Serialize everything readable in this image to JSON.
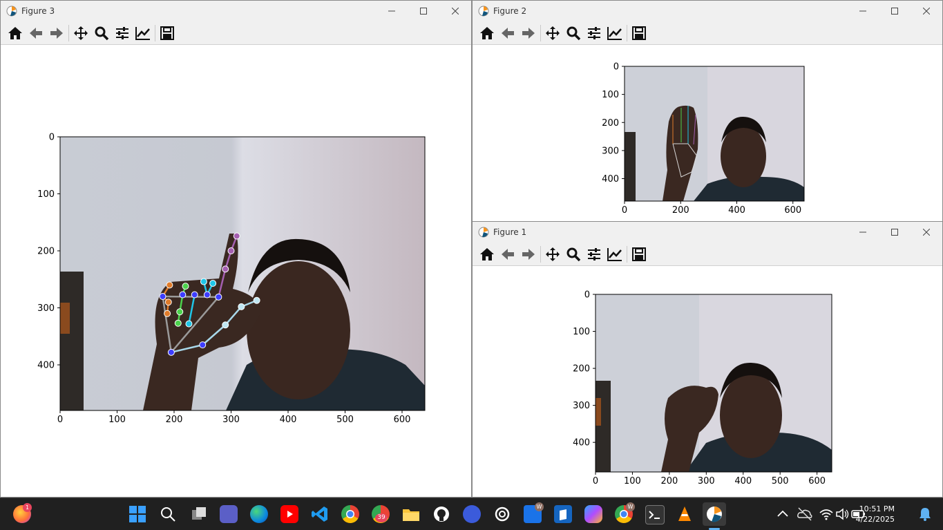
{
  "windows": {
    "fig3": {
      "title": "Figure 3"
    },
    "fig2": {
      "title": "Figure 2"
    },
    "fig1": {
      "title": "Figure 1"
    }
  },
  "toolbar_buttons": [
    "home-icon",
    "back-icon",
    "forward-icon",
    "pan-icon",
    "zoom-icon",
    "configure-subplots-icon",
    "edit-axis-icon",
    "save-icon"
  ],
  "axes": {
    "x_ticks": [
      "0",
      "100",
      "200",
      "300",
      "400",
      "500",
      "600"
    ],
    "y_ticks": [
      "0",
      "100",
      "200",
      "300",
      "400"
    ],
    "x_ticks_fig2": [
      "0",
      "200",
      "400",
      "600"
    ],
    "y_ticks_fig2": [
      "0",
      "100",
      "200",
      "300",
      "400"
    ]
  },
  "taskbar": {
    "time": "10:51 PM",
    "date": "4/22/2025",
    "badge_firefox": "1",
    "badge_calendar": "39",
    "badge_w1": "W",
    "badge_w2": "W"
  },
  "colors": {
    "taskbar_bg": "#202020",
    "window_chrome": "#f0f0f0"
  }
}
